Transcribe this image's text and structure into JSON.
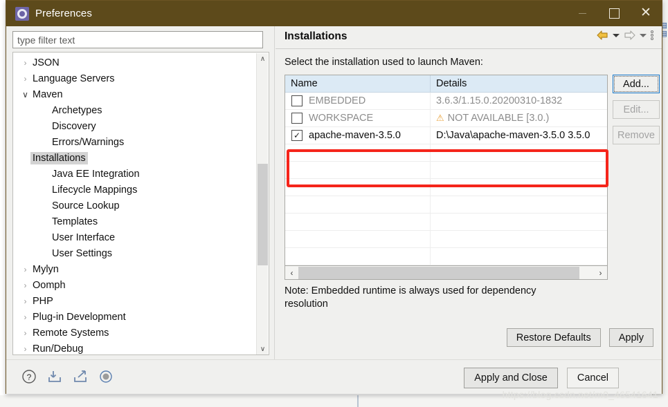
{
  "window": {
    "title": "Preferences",
    "icon": "preferences-gear-icon",
    "controls": {
      "minimize": "—",
      "maximize": "□",
      "close": "×"
    },
    "accent_titlebar": "#5d4a1b"
  },
  "filter": {
    "placeholder": "type filter text",
    "value": ""
  },
  "tree": {
    "items": [
      {
        "label": "JSON",
        "state": "collapsed",
        "level": 0,
        "selected": false
      },
      {
        "label": "Language Servers",
        "state": "collapsed",
        "level": 0,
        "selected": false
      },
      {
        "label": "Maven",
        "state": "expanded",
        "level": 0,
        "selected": false
      },
      {
        "label": "Archetypes",
        "state": "leaf",
        "level": 1,
        "selected": false
      },
      {
        "label": "Discovery",
        "state": "leaf",
        "level": 1,
        "selected": false
      },
      {
        "label": "Errors/Warnings",
        "state": "leaf",
        "level": 1,
        "selected": false
      },
      {
        "label": "Installations",
        "state": "leaf",
        "level": 1,
        "selected": true
      },
      {
        "label": "Java EE Integration",
        "state": "leaf",
        "level": 1,
        "selected": false
      },
      {
        "label": "Lifecycle Mappings",
        "state": "leaf",
        "level": 1,
        "selected": false
      },
      {
        "label": "Source Lookup",
        "state": "leaf",
        "level": 1,
        "selected": false
      },
      {
        "label": "Templates",
        "state": "leaf",
        "level": 1,
        "selected": false
      },
      {
        "label": "User Interface",
        "state": "leaf",
        "level": 1,
        "selected": false
      },
      {
        "label": "User Settings",
        "state": "leaf",
        "level": 1,
        "selected": false
      },
      {
        "label": "Mylyn",
        "state": "collapsed",
        "level": 0,
        "selected": false
      },
      {
        "label": "Oomph",
        "state": "collapsed",
        "level": 0,
        "selected": false
      },
      {
        "label": "PHP",
        "state": "collapsed",
        "level": 0,
        "selected": false
      },
      {
        "label": "Plug-in Development",
        "state": "collapsed",
        "level": 0,
        "selected": false
      },
      {
        "label": "Remote Systems",
        "state": "collapsed",
        "level": 0,
        "selected": false
      },
      {
        "label": "Run/Debug",
        "state": "collapsed",
        "level": 0,
        "selected": false
      }
    ],
    "scroll_up_glyph": "∧",
    "scroll_down_glyph": "∨"
  },
  "page": {
    "title": "Installations",
    "description": "Select the installation used to launch Maven:",
    "note": "Note: Embedded runtime is always used for dependency resolution",
    "toolbar": {
      "back_icon": "back-arrow-icon",
      "back_menu_icon": "chevron-down-icon",
      "forward_icon": "forward-arrow-icon",
      "forward_menu_icon": "chevron-down-icon",
      "menu_icon": "view-menu-icon"
    }
  },
  "table": {
    "columns": [
      "Name",
      "Details"
    ],
    "rows": [
      {
        "checked": false,
        "name": "EMBEDDED",
        "details": "3.6.3/1.15.0.20200310-1832",
        "dimmed": true,
        "warning": false
      },
      {
        "checked": false,
        "name": "WORKSPACE",
        "details": "NOT AVAILABLE [3.0.)",
        "dimmed": true,
        "warning": true
      },
      {
        "checked": true,
        "name": "apache-maven-3.5.0",
        "details": "D:\\Java\\apache-maven-3.5.0 3.5.0",
        "dimmed": false,
        "warning": false
      }
    ],
    "checked_glyph": "✓",
    "warning_glyph": "⚠",
    "hscroll_left_glyph": "‹",
    "hscroll_right_glyph": "›"
  },
  "side_buttons": [
    {
      "label": "Add...",
      "enabled": true,
      "focused": true,
      "mnemonic": "A"
    },
    {
      "label": "Edit...",
      "enabled": false,
      "focused": false,
      "mnemonic": "E"
    },
    {
      "label": "Remove",
      "enabled": false,
      "focused": false,
      "mnemonic": "R"
    }
  ],
  "page_buttons": [
    {
      "label": "Restore Defaults"
    },
    {
      "label": "Apply"
    }
  ],
  "footer": {
    "icons": [
      "help-icon",
      "import-icon",
      "export-icon",
      "record-icon"
    ],
    "buttons": [
      {
        "label": "Apply and Close",
        "primary": true
      },
      {
        "label": "Cancel",
        "primary": false
      }
    ]
  },
  "annotation": {
    "highlight_color": "#f5251b",
    "target": "apache-maven-3.5.0-row"
  },
  "watermark": "https://blog.csdn.net/m0_46541641"
}
